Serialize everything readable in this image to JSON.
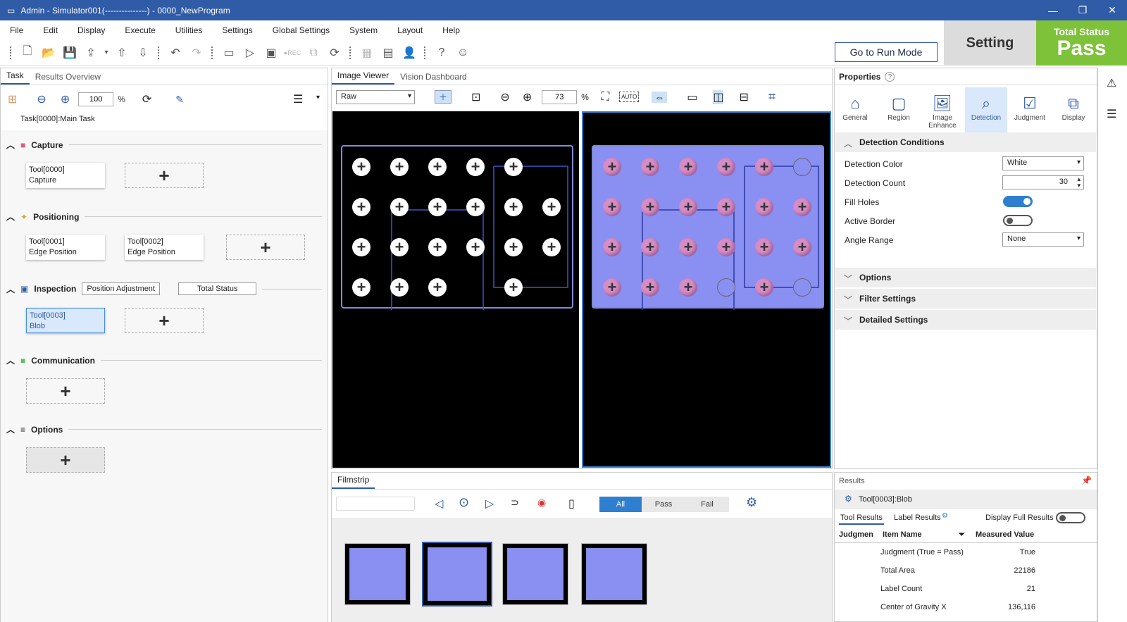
{
  "window": {
    "title": "Admin - Simulator001(---------------) - 0000_NewProgram"
  },
  "menu": [
    "File",
    "Edit",
    "Display",
    "Execute",
    "Utilities",
    "Settings",
    "Global Settings",
    "System",
    "Layout",
    "Help"
  ],
  "toolbar": {
    "run_mode": "Go to Run Mode",
    "mode": "Setting",
    "status_label": "Total Status",
    "status_value": "Pass"
  },
  "task_panel": {
    "tabs": [
      "Task",
      "Results Overview"
    ],
    "zoom": "100",
    "percent": "%",
    "task_name": "Task[0000]:Main Task",
    "sections": {
      "capture": "Capture",
      "positioning": "Positioning",
      "inspection": "Inspection",
      "communication": "Communication",
      "options": "Options"
    },
    "inspection_buttons": [
      "Position Adjustment",
      "Total Status"
    ],
    "tools": [
      {
        "id": "Tool[0000]",
        "name": "Capture"
      },
      {
        "id": "Tool[0001]",
        "name": "Edge Position"
      },
      {
        "id": "Tool[0002]",
        "name": "Edge Position"
      },
      {
        "id": "Tool[0003]",
        "name": "Blob"
      }
    ]
  },
  "viewer": {
    "tabs": [
      "Image Viewer",
      "Vision Dashboard"
    ],
    "image_mode": "Raw",
    "zoom": "73",
    "percent": "%",
    "auto": "AUTO"
  },
  "filmstrip": {
    "tab": "Filmstrip",
    "filters": [
      "All",
      "Pass",
      "Fail"
    ]
  },
  "properties": {
    "title": "Properties",
    "help": "?",
    "icons": [
      "General",
      "Region",
      "Image Enhance",
      "Detection",
      "Judgment",
      "Display"
    ],
    "section": "Detection Conditions",
    "rows": {
      "detection_color": "Detection Color",
      "detection_count": "Detection Count",
      "fill_holes": "Fill Holes",
      "active_border": "Active Border",
      "angle_range": "Angle Range"
    },
    "values": {
      "detection_color": "White",
      "detection_count": "30",
      "angle_range": "None"
    },
    "collapsed": [
      "Options",
      "Filter Settings",
      "Detailed Settings"
    ]
  },
  "results": {
    "title": "Results",
    "tool": "Tool[0003]:Blob",
    "tabs": [
      "Tool Results",
      "Label Results"
    ],
    "display_full": "Display Full Results",
    "columns": [
      "Judgmen",
      "Item Name",
      "Measured Value"
    ],
    "rows": [
      {
        "name": "Judgment (True = Pass)",
        "value": "True"
      },
      {
        "name": "Total Area",
        "value": "22186"
      },
      {
        "name": "Label Count",
        "value": "21"
      },
      {
        "name": "Center of Gravity X",
        "value": "136,116"
      }
    ]
  }
}
